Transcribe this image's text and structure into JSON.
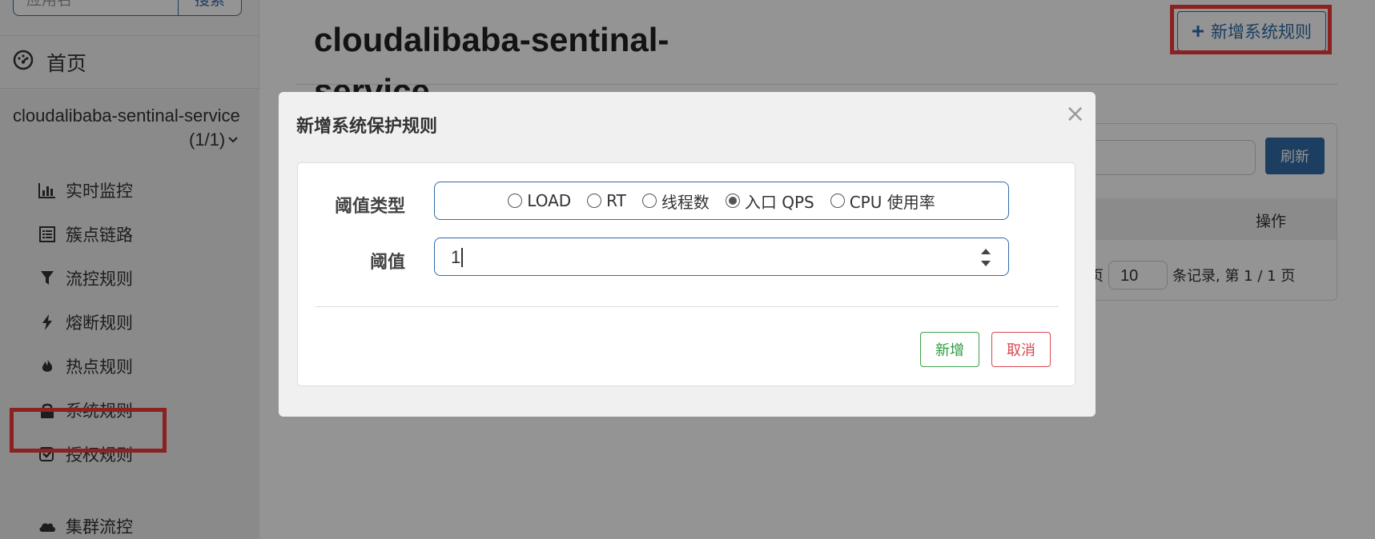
{
  "sidebar": {
    "search_placeholder": "应用名",
    "search_button": "搜索",
    "home_label": "首页",
    "app_name": "cloudalibaba-sentinal-service",
    "app_count": "(1/1)",
    "items": [
      {
        "label": "实时监控",
        "icon": "bar-chart-icon"
      },
      {
        "label": "簇点链路",
        "icon": "list-icon"
      },
      {
        "label": "流控规则",
        "icon": "filter-icon"
      },
      {
        "label": "熔断规则",
        "icon": "bolt-icon"
      },
      {
        "label": "热点规则",
        "icon": "fire-icon"
      },
      {
        "label": "系统规则",
        "icon": "lock-icon"
      },
      {
        "label": "授权规则",
        "icon": "check-square-icon"
      },
      {
        "label": "集群流控",
        "icon": "cloud-icon"
      }
    ]
  },
  "main": {
    "title": "cloudalibaba-sentinal-service",
    "add_button": "新增系统规则",
    "refresh_button": "刷新",
    "column_op": "操作",
    "pager": {
      "prefix": "页",
      "page_size": "10",
      "suffix": "条记录, 第 1 / 1 页"
    }
  },
  "modal": {
    "title": "新增系统保护规则",
    "close": "×",
    "type_label": "阈值类型",
    "options": [
      "LOAD",
      "RT",
      "线程数",
      "入口 QPS",
      "CPU 使用率"
    ],
    "selected_option": "入口 QPS",
    "threshold_label": "阈值",
    "threshold_value": "1",
    "add_button": "新增",
    "cancel_button": "取消"
  },
  "colors": {
    "primary": "#2f6ba8",
    "success": "#2a9d3f",
    "danger": "#d9474f",
    "highlight": "#f03a3a"
  }
}
